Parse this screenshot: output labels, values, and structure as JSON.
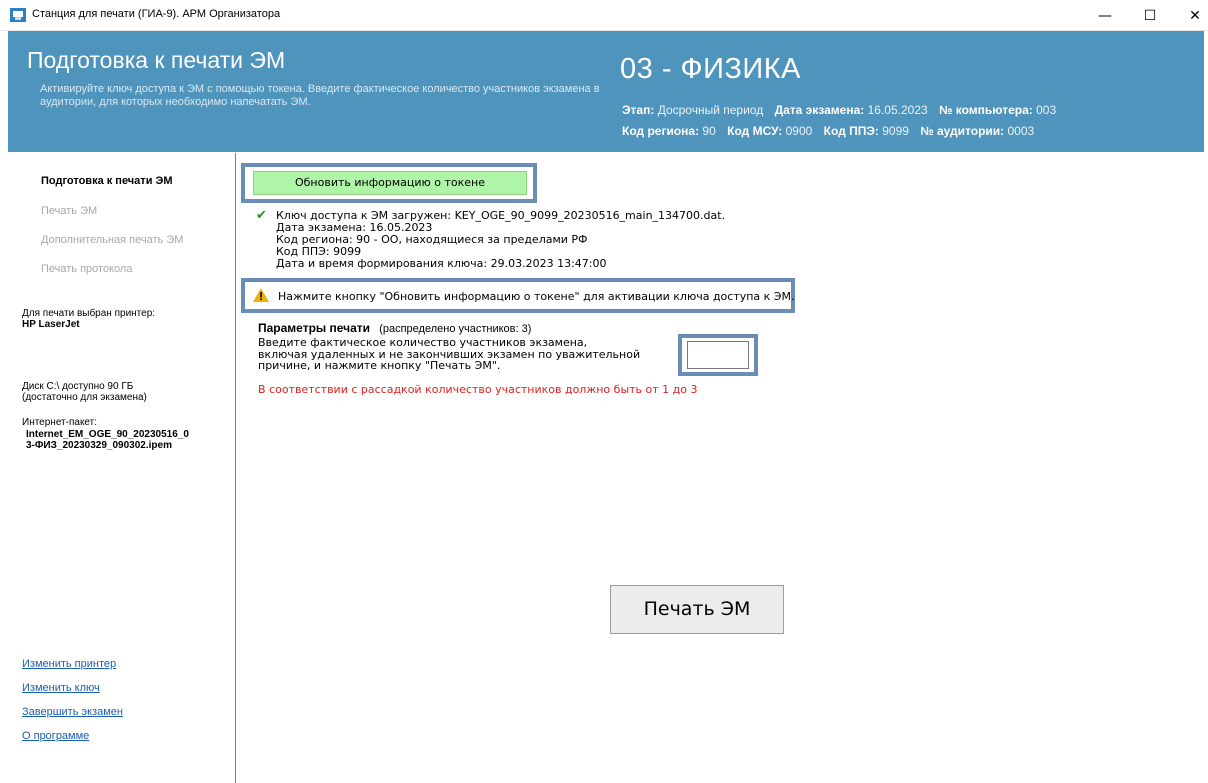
{
  "window": {
    "title": "Станция для печати (ГИА-9). АРМ Организатора",
    "minimize": "—",
    "maximize": "☐",
    "close": "✕"
  },
  "header": {
    "title": "Подготовка к печати ЭМ",
    "description": "Активируйте ключ доступа к ЭМ с помощью токена. Введите фактическое количество участников экзамена в аудитории, для которых необходимо напечатать ЭМ.",
    "subject": "03 - ФИЗИКА",
    "stage_label": "Этап:",
    "stage_value": "Досрочный период",
    "exam_date_label": "Дата экзамена:",
    "exam_date_value": "16.05.2023",
    "computer_label": "№ компьютера:",
    "computer_value": "003",
    "region_label": "Код региона:",
    "region_value": "90",
    "msu_label": "Код МСУ:",
    "msu_value": "0900",
    "ppe_label": "Код ППЭ:",
    "ppe_value": "9099",
    "room_label": "№ аудитории:",
    "room_value": "0003"
  },
  "sidebar": {
    "nav": [
      {
        "label": "Подготовка к печати ЭМ",
        "active": true
      },
      {
        "label": "Печать ЭМ",
        "active": false
      },
      {
        "label": "Дополнительная печать ЭМ",
        "active": false
      },
      {
        "label": "Печать протокола",
        "active": false
      }
    ],
    "printer_label": "Для печати выбран принтер:",
    "printer_value": "HP LaserJet",
    "disk_line1": "Диск C:\\ доступно 90 ГБ",
    "disk_line2": "(достаточно для экзамена)",
    "package_label": "Интернет-пакет:",
    "package_line1": "Internet_EM_OGE_90_20230516_0",
    "package_line2": "3-ФИЗ_20230329_090302.ipem",
    "links": [
      "Изменить принтер",
      "Изменить ключ",
      "Завершить экзамен",
      "О программе"
    ]
  },
  "main": {
    "refresh_button": "Обновить информацию о токене",
    "key_info": [
      "Ключ доступа к ЭМ загружен: KEY_OGE_90_9099_20230516_main_134700.dat.",
      "Дата экзамена: 16.05.2023",
      "Код региона: 90 - ОО, находящиеся за пределами РФ",
      "Код ППЭ: 9099",
      "Дата и время формирования ключа: 29.03.2023 13:47:00"
    ],
    "warning": "Нажмите кнопку \"Обновить информацию о токене\" для активации ключа доступа к ЭМ.",
    "params_title": "Параметры печати",
    "params_distributed": "(распределено участников: 3)",
    "params_desc": [
      "Введите фактическое количество участников экзамена,",
      "включая удаленных и не закончивших экзамен по уважительной",
      "причине, и нажмите кнопку \"Печать ЭМ\"."
    ],
    "count_value": "",
    "error": "В соответствии с рассадкой количество участников должно быть от 1 до 3",
    "print_button": "Печать ЭМ"
  },
  "colors": {
    "header_bg": "#4e94bc",
    "refresh_bg": "#aef5a7",
    "highlight": "#6a8db6",
    "error": "#e02020",
    "link": "#1a5eb0"
  }
}
